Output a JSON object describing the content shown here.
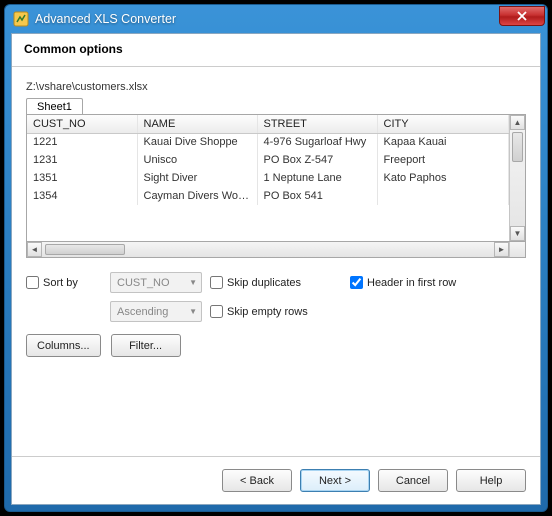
{
  "window": {
    "title": "Advanced XLS Converter"
  },
  "page": {
    "heading": "Common options",
    "filepath": "Z:\\vshare\\customers.xlsx"
  },
  "sheets": {
    "tabs": [
      "Sheet1"
    ]
  },
  "grid": {
    "columns": [
      "CUST_NO",
      "NAME",
      "STREET",
      "CITY"
    ],
    "rows": [
      {
        "cust_no": "1221",
        "name": "Kauai Dive Shoppe",
        "street": "4-976 Sugarloaf Hwy",
        "city": "Kapaa Kauai"
      },
      {
        "cust_no": "1231",
        "name": "Unisco",
        "street": "PO Box Z-547",
        "city": "Freeport"
      },
      {
        "cust_no": "1351",
        "name": "Sight Diver",
        "street": "1 Neptune Lane",
        "city": "Kato Paphos"
      },
      {
        "cust_no": "1354",
        "name": "Cayman Divers Worl...",
        "street": "PO Box 541",
        "city": ""
      }
    ]
  },
  "options": {
    "sort_by_label": "Sort by",
    "sort_by_checked": false,
    "sort_field": "CUST_NO",
    "sort_direction": "Ascending",
    "skip_duplicates_label": "Skip duplicates",
    "skip_duplicates_checked": false,
    "header_first_row_label": "Header in first row",
    "header_first_row_checked": true,
    "skip_empty_rows_label": "Skip empty rows",
    "skip_empty_rows_checked": false
  },
  "buttons": {
    "columns": "Columns...",
    "filter": "Filter...",
    "back": "< Back",
    "next": "Next >",
    "cancel": "Cancel",
    "help": "Help"
  }
}
